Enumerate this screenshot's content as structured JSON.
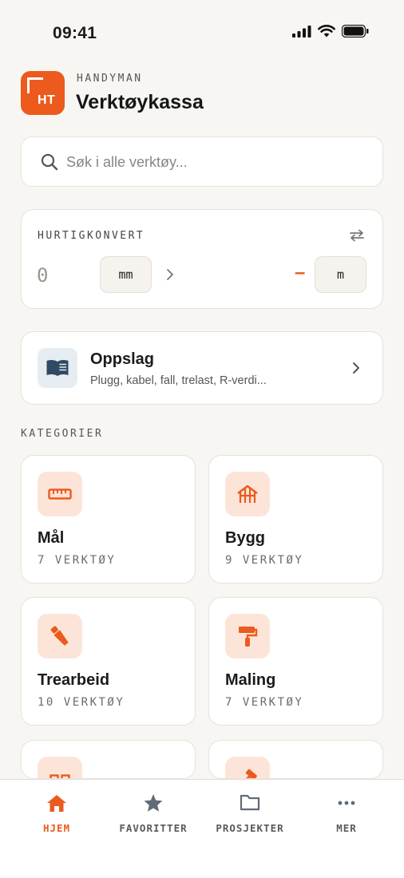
{
  "status_bar": {
    "time": "09:41"
  },
  "header": {
    "logo_text": "HT",
    "eyebrow": "HANDYMAN",
    "title": "Verktøykassa"
  },
  "search": {
    "placeholder": "Søk i alle verktøy...",
    "value": ""
  },
  "converter": {
    "title": "HURTIGKONVERT",
    "input_value": "0",
    "from_unit": "mm",
    "to_unit": "m",
    "result": "–"
  },
  "lookup": {
    "title": "Oppslag",
    "subtitle": "Plugg, kabel, fall, trelast, R-verdi..."
  },
  "categories": {
    "title": "KATEGORIER",
    "items": [
      {
        "name": "Mål",
        "count": "7 VERKTØY",
        "icon": "ruler-icon"
      },
      {
        "name": "Bygg",
        "count": "9 VERKTØY",
        "icon": "house-frame-icon"
      },
      {
        "name": "Trearbeid",
        "count": "10 VERKTØY",
        "icon": "saw-icon"
      },
      {
        "name": "Maling",
        "count": "7 VERKTØY",
        "icon": "paint-roller-icon"
      },
      {
        "name": "",
        "count": "",
        "icon": "tiles-icon"
      },
      {
        "name": "",
        "count": "",
        "icon": "hammer-icon"
      }
    ]
  },
  "tabs": [
    {
      "label": "HJEM",
      "icon": "home-icon",
      "active": true
    },
    {
      "label": "FAVORITTER",
      "icon": "star-icon",
      "active": false
    },
    {
      "label": "PROSJEKTER",
      "icon": "folder-icon",
      "active": false
    },
    {
      "label": "MER",
      "icon": "more-icon",
      "active": false
    }
  ],
  "colors": {
    "accent": "#ec5a1d",
    "background": "#f8f6f3",
    "icon_tint_bg": "#fce5d8",
    "lookup_icon": "#2f4a63"
  }
}
